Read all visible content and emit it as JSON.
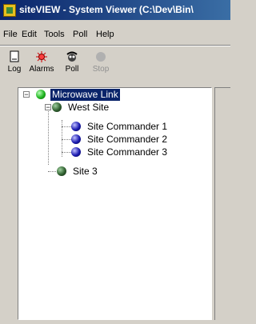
{
  "window": {
    "title": "siteVIEW - System Viewer (C:\\Dev\\Bin\\"
  },
  "menu": {
    "items": [
      {
        "label": "File"
      },
      {
        "label": "Edit"
      },
      {
        "label": "Tools"
      },
      {
        "label": "Poll"
      },
      {
        "label": "Help"
      }
    ]
  },
  "toolbar": {
    "buttons": [
      {
        "label": "Log",
        "enabled": true
      },
      {
        "label": "Alarms",
        "enabled": true
      },
      {
        "label": "Poll",
        "enabled": true
      },
      {
        "label": "Stop",
        "enabled": false
      }
    ]
  },
  "tree": {
    "root": {
      "label": "Microwave Link",
      "status": "green",
      "selected": true,
      "expanded": true
    },
    "west_site": {
      "label": "West Site",
      "status": "darkgreen",
      "expanded": true
    },
    "commanders": [
      {
        "label": "Site Commander 1",
        "status": "blue"
      },
      {
        "label": "Site Commander 2",
        "status": "blue"
      },
      {
        "label": "Site Commander 3",
        "status": "blue"
      }
    ],
    "site3": {
      "label": "Site 3",
      "status": "darkgreen"
    }
  },
  "colors": {
    "title_bar": "#0a246a",
    "selection": "#0a246a"
  }
}
